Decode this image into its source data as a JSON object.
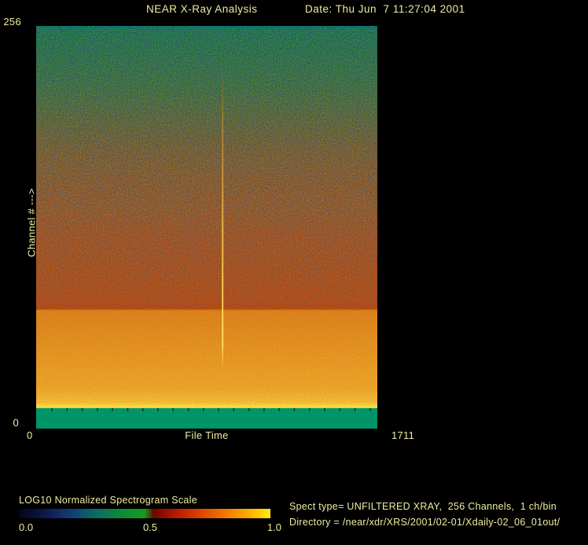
{
  "header": {
    "title": "NEAR X-Ray Analysis",
    "date": "Date: Thu Jun  7 11:27:04 2001"
  },
  "plot": {
    "y_axis": {
      "title": "Channel # --->",
      "max_label": "256",
      "min_label": "0"
    },
    "x_axis": {
      "title": "File Time",
      "min_label": "0",
      "max_label": "1711"
    }
  },
  "colorbar": {
    "title": "LOG10 Normalized Spectrogram Scale",
    "tick_labels": [
      "0.0",
      "0.5",
      "1.0"
    ]
  },
  "info": {
    "line1": "Spect type= UNFILTERED XRAY,  256 Channels,  1 ch/bin",
    "line2": "Directory = /near/xdr/XRS/2001/02-01/Xdaily-02_06_01out/"
  },
  "chart_data": {
    "type": "heatmap",
    "title": "NEAR X-Ray Analysis",
    "xlabel": "File Time",
    "ylabel": "Channel # --->",
    "xlim": [
      0,
      1711
    ],
    "ylim": [
      0,
      256
    ],
    "grid": false,
    "x_minor_tick_interval": 76,
    "colorbar": {
      "label": "LOG10 Normalized Spectrogram Scale",
      "ticks": [
        0.0,
        0.5,
        1.0
      ],
      "position": "bottom-left",
      "stops": [
        [
          0.0,
          "#05051e"
        ],
        [
          0.08,
          "#0b1240"
        ],
        [
          0.16,
          "#122a68"
        ],
        [
          0.24,
          "#0e4e70"
        ],
        [
          0.32,
          "#0b6f62"
        ],
        [
          0.4,
          "#0b8a38"
        ],
        [
          0.5,
          "#129e1e"
        ],
        [
          0.535,
          "#6a0800"
        ],
        [
          0.6,
          "#a81200"
        ],
        [
          0.68,
          "#d03000"
        ],
        [
          0.76,
          "#e65800"
        ],
        [
          0.84,
          "#f58200"
        ],
        [
          0.92,
          "#ffb100"
        ],
        [
          0.97,
          "#ffd800"
        ],
        [
          1.0,
          "#ffe81e"
        ]
      ]
    },
    "bands": [
      {
        "channels": [
          255,
          256
        ],
        "color": "#009468",
        "desc": "solid teal row at top edge"
      },
      {
        "channels": [
          206,
          255
        ],
        "color": "#279040",
        "desc": "green noise with dark navy speckles, normalized value ~0.45"
      },
      {
        "channels": [
          146,
          206
        ],
        "color": "#7c6822",
        "desc": "mixed green-red speckle transition zone"
      },
      {
        "channels": [
          75,
          146
        ],
        "color": "#c84008",
        "desc": "red noisy region, normalized value ~0.65"
      },
      {
        "channels": [
          15,
          75
        ],
        "color": "#ef8c16",
        "desc": "orange region brightening toward low channels, ~0.8"
      },
      {
        "channels": [
          13,
          15
        ],
        "color": "#ffd934",
        "desc": "bright yellow fringe, ~0.95"
      },
      {
        "channels": [
          0,
          13
        ],
        "color": "#009468",
        "desc": "solid teal bottom band, ~0.42"
      }
    ],
    "features": [
      {
        "type": "vertical-streak",
        "file_time": 935,
        "channels": [
          38,
          230
        ],
        "color": "#ffd040",
        "desc": "bright burst column near middle of file time range"
      }
    ],
    "gradient_stops": [
      [
        0.0,
        "#009468"
      ],
      [
        0.005,
        "#009468"
      ],
      [
        0.007,
        "#279040"
      ],
      [
        0.15,
        "#3d8732"
      ],
      [
        0.3,
        "#7c6822"
      ],
      [
        0.42,
        "#aa4c10"
      ],
      [
        0.52,
        "#c24008"
      ],
      [
        0.7,
        "#ca4406"
      ],
      [
        0.703,
        "#cc4a06"
      ],
      [
        0.707,
        "#e98413"
      ],
      [
        0.82,
        "#f0971b"
      ],
      [
        0.9,
        "#f4a521"
      ],
      [
        0.935,
        "#f9b92a"
      ],
      [
        0.944,
        "#ffd934"
      ],
      [
        0.948,
        "#ffe23b"
      ],
      [
        0.95,
        "#009468"
      ],
      [
        1.0,
        "#009468"
      ]
    ]
  }
}
